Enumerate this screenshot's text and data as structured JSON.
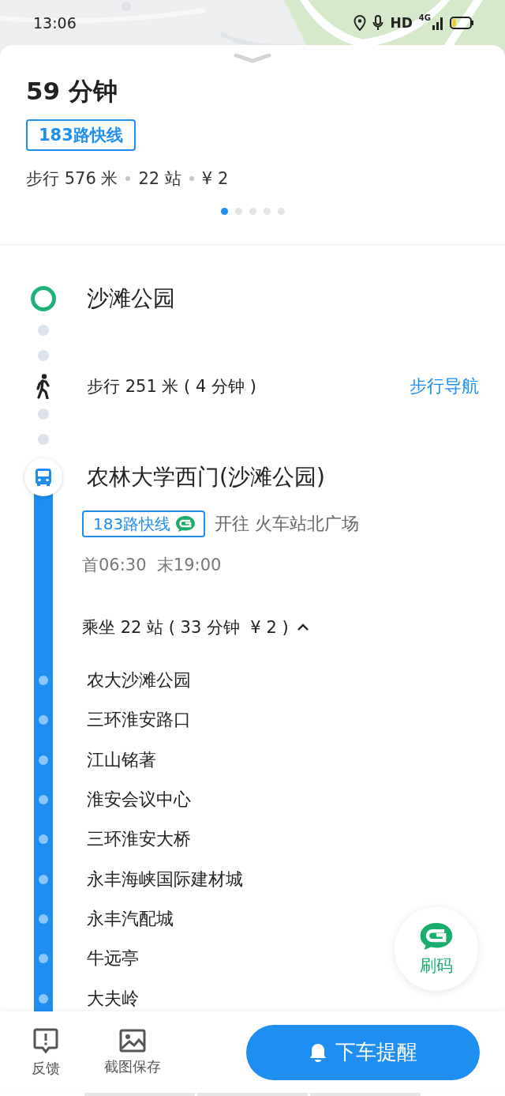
{
  "status_bar": {
    "time": "13:06",
    "hd": "HD",
    "network": "4G"
  },
  "summary": {
    "duration": "59 分钟",
    "line_tag": "183路快线",
    "parts": [
      "步行 576 米",
      "22 站",
      "¥ 2"
    ]
  },
  "pager": [
    {
      "selected": true
    },
    {
      "selected": false
    },
    {
      "selected": false
    },
    {
      "selected": false
    },
    {
      "selected": false
    }
  ],
  "route": {
    "start": {
      "name": "沙滩公园"
    },
    "walk": {
      "text": "步行 251 米 ( 4 分钟 )",
      "action": "步行导航"
    },
    "board": {
      "stop": "农林大学西门(沙滩公园)",
      "line": "183路快线",
      "direction": "开往 火车站北广场",
      "times": "首06:30  末19:00",
      "ride": "乘坐 22 站 ( 33 分钟  ¥ 2 )",
      "expanded": true
    },
    "stops": [
      "农大沙滩公园",
      "三环淮安路口",
      "江山铭著",
      "淮安会议中心",
      "三环淮安大桥",
      "永丰海峡国际建材城",
      "永丰汽配城",
      "牛远亭",
      "大夫岭"
    ]
  },
  "float_button": {
    "label": "刷码"
  },
  "bottom_bar": {
    "actions": [
      {
        "kind": "feedback",
        "label": "反馈"
      },
      {
        "kind": "screenshot",
        "label": "截图保存"
      }
    ],
    "primary": {
      "label": "下车提醒"
    }
  }
}
